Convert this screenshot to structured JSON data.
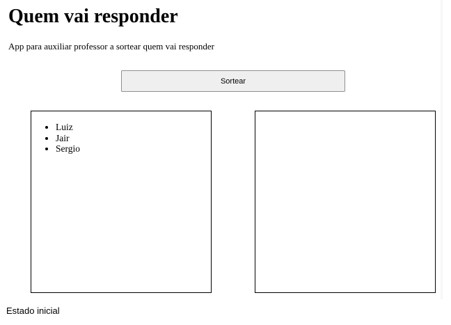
{
  "header": {
    "title": "Quem vai responder",
    "subtitle": "App para auxiliar professor a sortear quem vai responder"
  },
  "actions": {
    "draw_label": "Sortear"
  },
  "students": {
    "items": [
      "Luiz",
      "Jair",
      "Sergio"
    ]
  },
  "caption": "Estado inicial"
}
